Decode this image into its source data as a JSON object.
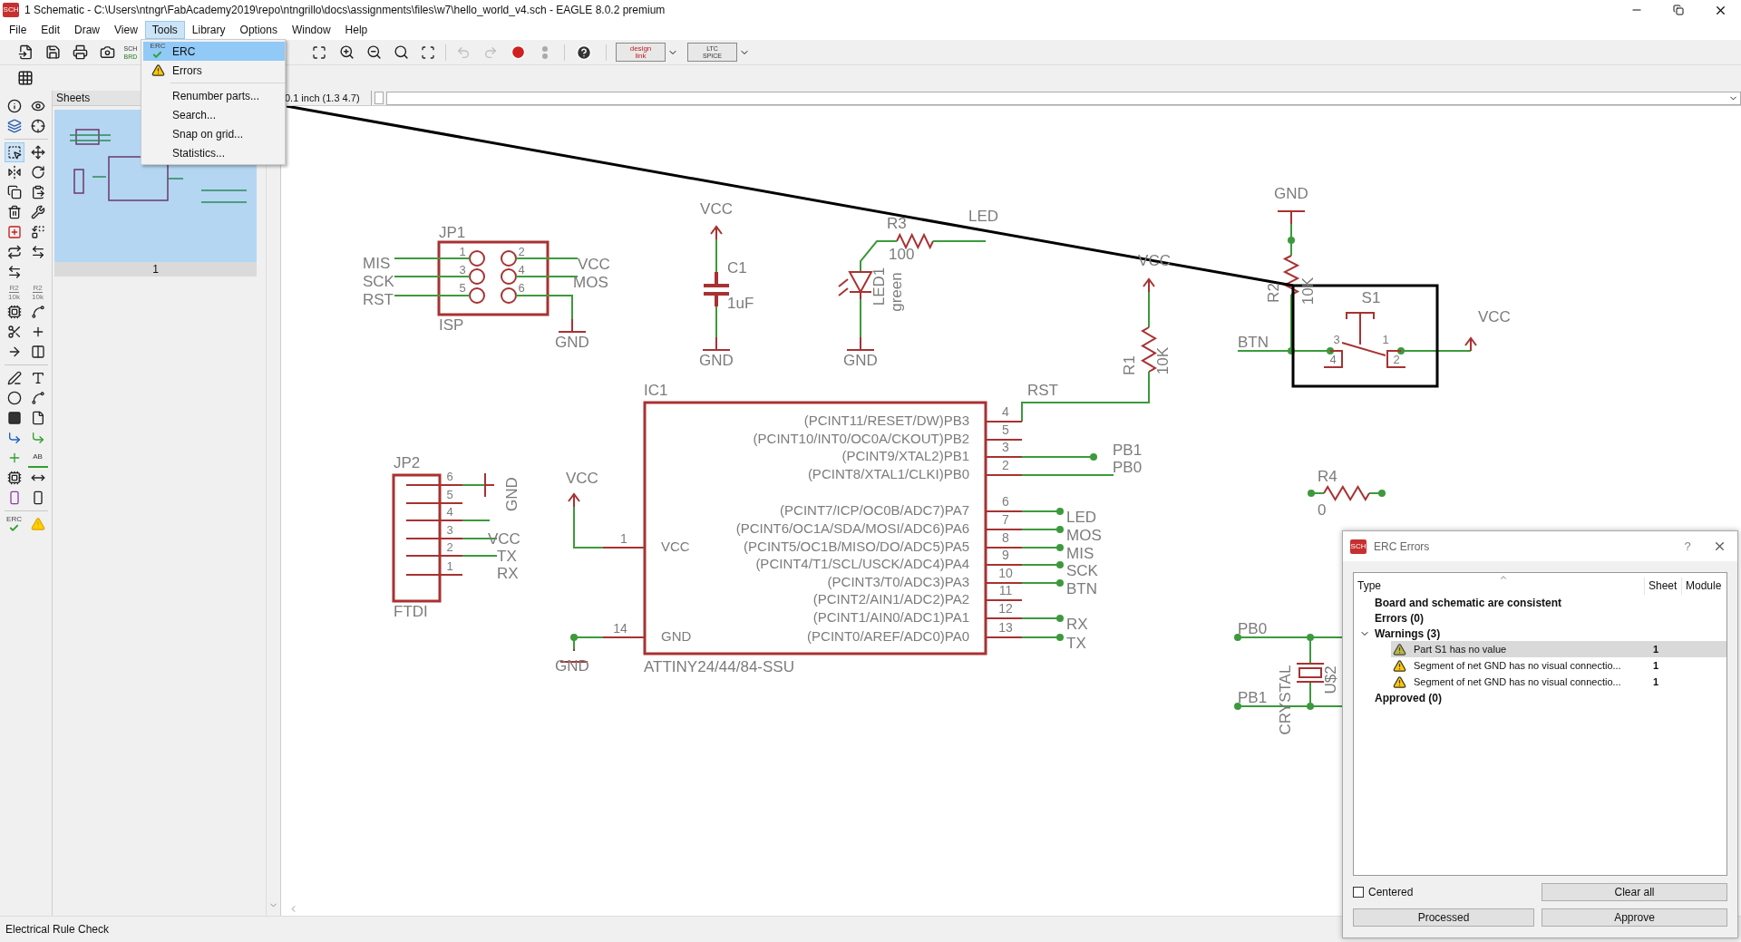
{
  "window": {
    "icon_text": "SCH",
    "title": "1 Schematic - C:\\Users\\ntngr\\FabAcademy2019\\repo\\ntngrillo\\docs\\assignments\\files\\w7\\hello_world_v4.sch - EAGLE 8.0.2 premium"
  },
  "menu": [
    {
      "label": "File",
      "selected": false
    },
    {
      "label": "Edit",
      "selected": false
    },
    {
      "label": "Draw",
      "selected": false
    },
    {
      "label": "View",
      "selected": false
    },
    {
      "label": "Tools",
      "selected": true
    },
    {
      "label": "Library",
      "selected": false
    },
    {
      "label": "Options",
      "selected": false
    },
    {
      "label": "Window",
      "selected": false
    },
    {
      "label": "Help",
      "selected": false
    }
  ],
  "tools_menu": [
    {
      "kind": "erc",
      "icon_text": "ERC",
      "label": "ERC",
      "selected": true
    },
    {
      "kind": "warning",
      "label": "Errors",
      "selected": false
    },
    {
      "kind": "separator"
    },
    {
      "kind": "item",
      "label": "Renumber parts...",
      "selected": false
    },
    {
      "kind": "item",
      "label": "Search...",
      "selected": false
    },
    {
      "kind": "item",
      "label": "Snap on grid...",
      "selected": false
    },
    {
      "kind": "item",
      "label": "Statistics...",
      "selected": false
    }
  ],
  "toolbar": {
    "sch_brd": [
      "SCH",
      "BRD"
    ],
    "undo": {
      "disabled": true
    },
    "redo": {
      "disabled": true
    },
    "design_link": [
      "design",
      "link"
    ],
    "ltspice": [
      "LTC",
      "SPICE"
    ]
  },
  "left_toolbar": {
    "name_tool": [
      "R2",
      "10k"
    ],
    "value_tool": [
      "R2",
      "10k"
    ],
    "label_tool": "AB",
    "erc_tool": "ERC"
  },
  "sheets_panel": {
    "title": "Sheets",
    "sheets": [
      {
        "label": "1",
        "selected": true
      }
    ]
  },
  "coordinates": "0.1 inch (1.3 4.7)",
  "schematic": {
    "labels": [
      "JP1",
      "1",
      "3",
      "5",
      "2",
      "4",
      "6",
      "ISP",
      "MIS",
      "SCK",
      "RST",
      "VCC",
      "MOS",
      "GND",
      "VCC",
      "C1",
      "1uF",
      "GND",
      "R3",
      "100",
      "LED",
      "LED1",
      "green",
      "GND",
      "VCC",
      "R1",
      "10K",
      "RST",
      "GND",
      "R2",
      "10K",
      "S1",
      "3",
      "4",
      "1",
      "2",
      "BTN",
      "VCC",
      "R4",
      "0",
      "PB0",
      "PB1",
      "CRYSTAL",
      "U$2",
      "IC1",
      "ATTINY24/44/84-SSU",
      "(PCINT11/RESET/DW)PB3",
      "(PCINT10/INT0/OC0A/CKOUT)PB2",
      "(PCINT9/XTAL2)PB1",
      "(PCINT8/XTAL1/CLKI)PB0",
      "(PCINT7/ICP/OC0B/ADC7)PA7",
      "(PCINT6/OC1A/SDA/MOSI/ADC6)PA6",
      "(PCINT5/OC1B/MISO/DO/ADC5)PA5",
      "(PCINT4/T1/SCL/USCK/ADC4)PA4",
      "(PCINT3/T0/ADC3)PA3",
      "(PCINT2/AIN1/ADC2)PA2",
      "(PCINT1/AIN0/ADC1)PA1",
      "(PCINT0/AREF/ADC0)PA0",
      "4",
      "5",
      "3",
      "2",
      "6",
      "7",
      "8",
      "9",
      "10",
      "11",
      "12",
      "13",
      "VCC",
      "GND",
      "1",
      "14",
      "VCC",
      "GND",
      "PB1",
      "PB0",
      "LED",
      "MOS",
      "MIS",
      "SCK",
      "BTN",
      "RX",
      "TX",
      "JP2",
      "FTDI",
      "6",
      "5",
      "4",
      "3",
      "2",
      "1",
      "GND",
      "VCC",
      "TX",
      "RX"
    ]
  },
  "erc_dialog": {
    "icon_text": "SCH",
    "title": "ERC Errors",
    "help": "?",
    "columns": [
      "Type",
      "Sheet",
      "Module"
    ],
    "rows": [
      {
        "kind": "group",
        "label": "Board and schematic are consistent"
      },
      {
        "kind": "group",
        "label": "Errors (0)"
      },
      {
        "kind": "group",
        "label": "Warnings (3)",
        "expanded": true,
        "children": [
          {
            "label": "Part S1 has no value",
            "sheet": "1",
            "selected": true
          },
          {
            "label": "Segment of net GND has no visual connectio...",
            "sheet": "1",
            "selected": false
          },
          {
            "label": "Segment of net GND has no visual connectio...",
            "sheet": "1",
            "selected": false
          }
        ]
      },
      {
        "kind": "group",
        "label": "Approved (0)"
      }
    ],
    "centered": {
      "label": "Centered",
      "checked": false
    },
    "buttons": [
      "Clear all",
      "Processed",
      "Approve"
    ]
  },
  "status_bar": "Electrical Rule Check"
}
